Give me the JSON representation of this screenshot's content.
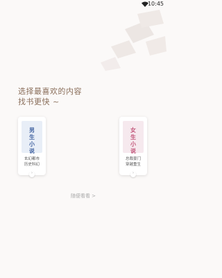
{
  "status_bar": {
    "time": "10:45"
  },
  "headline": {
    "line1": "选择最喜欢的内容",
    "line2": "找书更快 ~"
  },
  "cards": {
    "male": {
      "title": "男生小说",
      "genres": [
        "玄幻都市",
        "历史科幻"
      ],
      "arrow": "›"
    },
    "female": {
      "title": "女生小说",
      "genres": [
        "总裁豪门",
        "穿越重生"
      ],
      "arrow": "›"
    }
  },
  "random": {
    "label": "随便看看 >"
  },
  "colors": {
    "headline": "#8a6e5a",
    "male_accent": "#4465a2",
    "female_accent": "#c2567a"
  }
}
